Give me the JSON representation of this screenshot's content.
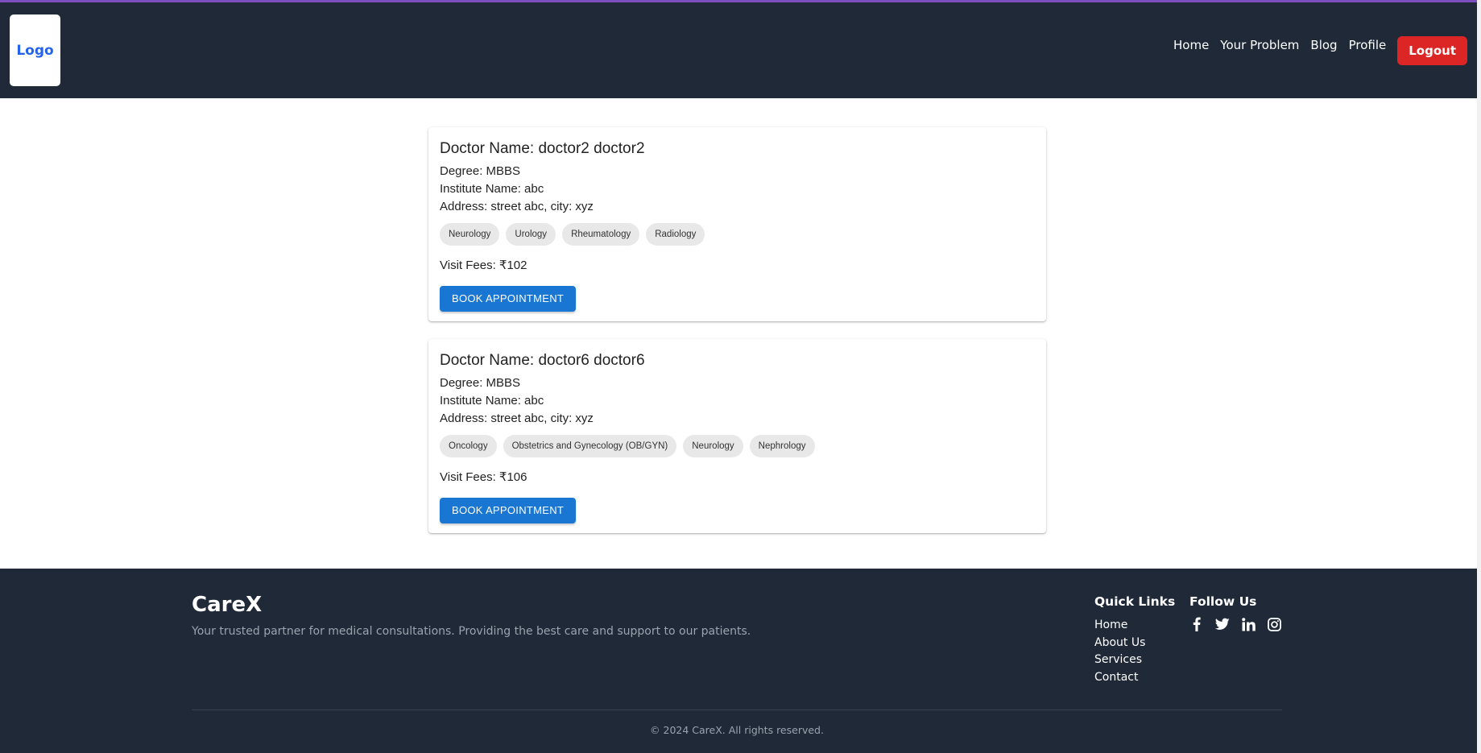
{
  "navbar": {
    "logo": "Logo",
    "links": [
      "Home",
      "Your Problem",
      "Blog",
      "Profile"
    ],
    "logout": "Logout"
  },
  "doctors": [
    {
      "name": "Doctor Name: doctor2 doctor2",
      "degree": "Degree: MBBS",
      "institute": "Institute Name: abc",
      "address": "Address: street abc, city: xyz",
      "specialties": [
        "Neurology",
        "Urology",
        "Rheumatology",
        "Radiology"
      ],
      "fees": "Visit Fees: ₹102",
      "button": "BOOK APPOINTMENT"
    },
    {
      "name": "Doctor Name: doctor6 doctor6",
      "degree": "Degree: MBBS",
      "institute": "Institute Name: abc",
      "address": "Address: street abc, city: xyz",
      "specialties": [
        "Oncology",
        "Obstetrics and Gynecology (OB/GYN)",
        "Neurology",
        "Nephrology"
      ],
      "fees": "Visit Fees: ₹106",
      "button": "BOOK APPOINTMENT"
    }
  ],
  "footer": {
    "brand": "CareX",
    "tagline": "Your trusted partner for medical consultations. Providing the best care and support to our patients.",
    "quick_links_heading": "Quick Links",
    "quick_links": [
      "Home",
      "About Us",
      "Services",
      "Contact"
    ],
    "follow_heading": "Follow Us",
    "social_icons": [
      "facebook-icon",
      "twitter-icon",
      "linkedin-icon",
      "instagram-icon"
    ],
    "copyright": "© 2024 CareX. All rights reserved."
  },
  "colors": {
    "navbar_bg": "#1f2937",
    "accent": "#7c4dbd",
    "logout": "#dc2626",
    "primary_button": "#1976d2",
    "logo_text": "#2563eb"
  }
}
